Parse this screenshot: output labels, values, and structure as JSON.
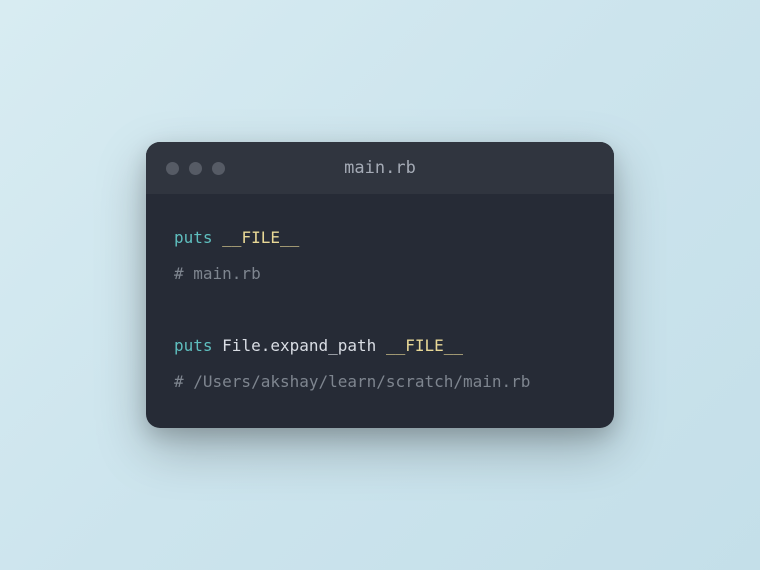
{
  "window": {
    "title": "main.rb"
  },
  "code": {
    "line1": {
      "keyword": "puts",
      "constant": "__FILE__"
    },
    "line2": {
      "comment": "# main.rb"
    },
    "line3": {
      "keyword": "puts",
      "class": "File",
      "dot": ".",
      "method": "expand_path",
      "constant": "__FILE__"
    },
    "line4": {
      "comment": "# /Users/akshay/learn/scratch/main.rb"
    }
  }
}
